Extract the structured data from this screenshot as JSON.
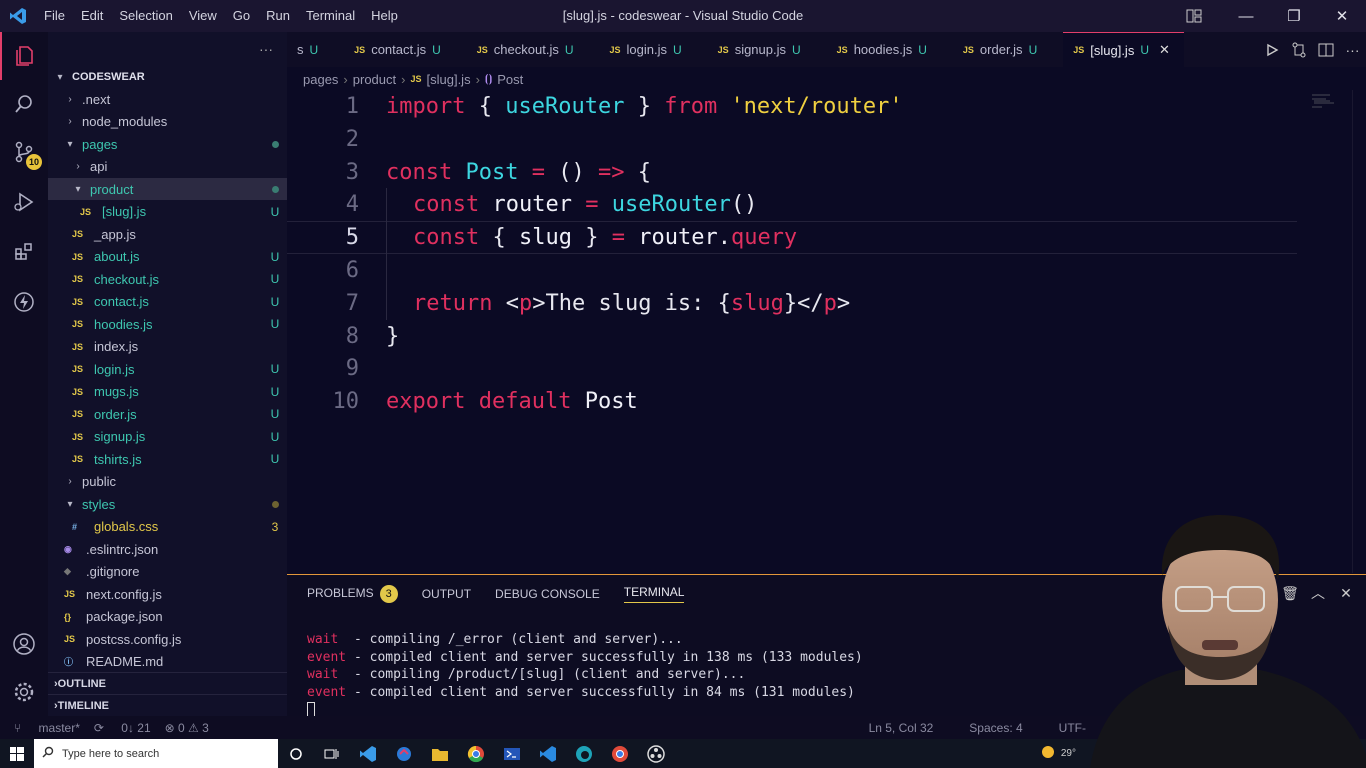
{
  "window": {
    "title": "[slug].js - codeswear - Visual Studio Code",
    "menu": [
      "File",
      "Edit",
      "Selection",
      "View",
      "Go",
      "Run",
      "Terminal",
      "Help"
    ]
  },
  "activity_bar": {
    "source_control_badge": "10"
  },
  "sidebar": {
    "more_label": "···",
    "project": "CODESWEAR",
    "tree": [
      {
        "label": ".next",
        "kind": "folder",
        "depth": 1,
        "open": false,
        "status": ""
      },
      {
        "label": "node_modules",
        "kind": "folder",
        "depth": 1,
        "open": false,
        "status": ""
      },
      {
        "label": "pages",
        "kind": "folder",
        "depth": 1,
        "open": true,
        "status": "dot"
      },
      {
        "label": "api",
        "kind": "folder",
        "depth": 2,
        "open": false,
        "status": ""
      },
      {
        "label": "product",
        "kind": "folder",
        "depth": 2,
        "open": true,
        "status": "dot",
        "selected": true
      },
      {
        "label": "[slug].js",
        "kind": "js",
        "depth": 3,
        "status": "U"
      },
      {
        "label": "_app.js",
        "kind": "js",
        "depth": 2,
        "status": ""
      },
      {
        "label": "about.js",
        "kind": "js",
        "depth": 2,
        "status": "U"
      },
      {
        "label": "checkout.js",
        "kind": "js",
        "depth": 2,
        "status": "U"
      },
      {
        "label": "contact.js",
        "kind": "js",
        "depth": 2,
        "status": "U"
      },
      {
        "label": "hoodies.js",
        "kind": "js",
        "depth": 2,
        "status": "U"
      },
      {
        "label": "index.js",
        "kind": "js",
        "depth": 2,
        "status": ""
      },
      {
        "label": "login.js",
        "kind": "js",
        "depth": 2,
        "status": "U"
      },
      {
        "label": "mugs.js",
        "kind": "js",
        "depth": 2,
        "status": "U"
      },
      {
        "label": "order.js",
        "kind": "js",
        "depth": 2,
        "status": "U"
      },
      {
        "label": "signup.js",
        "kind": "js",
        "depth": 2,
        "status": "U"
      },
      {
        "label": "tshirts.js",
        "kind": "js",
        "depth": 2,
        "status": "U"
      },
      {
        "label": "public",
        "kind": "folder",
        "depth": 1,
        "open": false,
        "status": ""
      },
      {
        "label": "styles",
        "kind": "folder",
        "depth": 1,
        "open": true,
        "status": "ydot"
      },
      {
        "label": "globals.css",
        "kind": "css",
        "depth": 2,
        "status": "3"
      },
      {
        "label": ".eslintrc.json",
        "kind": "eslint",
        "depth": 1,
        "status": ""
      },
      {
        "label": ".gitignore",
        "kind": "git",
        "depth": 1,
        "status": ""
      },
      {
        "label": "next.config.js",
        "kind": "js",
        "depth": 1,
        "status": ""
      },
      {
        "label": "package.json",
        "kind": "json",
        "depth": 1,
        "status": ""
      },
      {
        "label": "postcss.config.js",
        "kind": "js",
        "depth": 1,
        "status": ""
      },
      {
        "label": "README.md",
        "kind": "md",
        "depth": 1,
        "status": ""
      }
    ],
    "outline": "OUTLINE",
    "timeline": "TIMELINE"
  },
  "tabs": [
    {
      "label": "s",
      "u": "U",
      "partial": true
    },
    {
      "label": "contact.js",
      "u": "U"
    },
    {
      "label": "checkout.js",
      "u": "U"
    },
    {
      "label": "login.js",
      "u": "U"
    },
    {
      "label": "signup.js",
      "u": "U"
    },
    {
      "label": "hoodies.js",
      "u": "U"
    },
    {
      "label": "order.js",
      "u": "U"
    },
    {
      "label": "[slug].js",
      "u": "U",
      "active": true
    }
  ],
  "breadcrumb": {
    "parts": [
      "pages",
      "product",
      "[slug].js",
      "Post"
    ]
  },
  "editor": {
    "current_line": 5,
    "lines": [
      {
        "n": "1",
        "indent": 0,
        "tokens": [
          [
            "k",
            "import"
          ],
          [
            "p",
            " { "
          ],
          [
            "f",
            "useRouter"
          ],
          [
            "p",
            " } "
          ],
          [
            "k",
            "from"
          ],
          [
            "p",
            " "
          ],
          [
            "s",
            "'next/router'"
          ]
        ]
      },
      {
        "n": "2",
        "indent": 0,
        "tokens": []
      },
      {
        "n": "3",
        "indent": 0,
        "tokens": [
          [
            "k",
            "const"
          ],
          [
            "p",
            " "
          ],
          [
            "f",
            "Post"
          ],
          [
            "p",
            " "
          ],
          [
            "k",
            "="
          ],
          [
            "p",
            " () "
          ],
          [
            "k",
            "=>"
          ],
          [
            "p",
            " {"
          ]
        ]
      },
      {
        "n": "4",
        "indent": 1,
        "tokens": [
          [
            "k",
            "const"
          ],
          [
            "p",
            " "
          ],
          [
            "v",
            "router"
          ],
          [
            "p",
            " "
          ],
          [
            "k",
            "="
          ],
          [
            "p",
            " "
          ],
          [
            "f",
            "useRouter"
          ],
          [
            "p",
            "()"
          ]
        ]
      },
      {
        "n": "5",
        "indent": 1,
        "tokens": [
          [
            "k",
            "const"
          ],
          [
            "p",
            " { "
          ],
          [
            "v",
            "slug"
          ],
          [
            "p",
            " } "
          ],
          [
            "k",
            "="
          ],
          [
            "p",
            " "
          ],
          [
            "v",
            "router"
          ],
          [
            "p",
            "."
          ],
          [
            "pr",
            "query"
          ]
        ]
      },
      {
        "n": "6",
        "indent": 1,
        "tokens": []
      },
      {
        "n": "7",
        "indent": 1,
        "tokens": [
          [
            "k",
            "return"
          ],
          [
            "p",
            " <"
          ],
          [
            "t",
            "p"
          ],
          [
            "p",
            ">The slug is: {"
          ],
          [
            "pr",
            "slug"
          ],
          [
            "p",
            "}</"
          ],
          [
            "t",
            "p"
          ],
          [
            "p",
            ">"
          ]
        ]
      },
      {
        "n": "8",
        "indent": 0,
        "tokens": [
          [
            "p",
            "}"
          ]
        ]
      },
      {
        "n": "9",
        "indent": 0,
        "tokens": []
      },
      {
        "n": "10",
        "indent": 0,
        "tokens": [
          [
            "k",
            "export"
          ],
          [
            "p",
            " "
          ],
          [
            "k",
            "default"
          ],
          [
            "p",
            " "
          ],
          [
            "v",
            "Post"
          ]
        ]
      }
    ]
  },
  "panel": {
    "tabs": [
      "PROBLEMS",
      "OUTPUT",
      "DEBUG CONSOLE",
      "TERMINAL"
    ],
    "problems_count": "3",
    "active": "TERMINAL",
    "terminal": [
      {
        "tag": "wait",
        "text": "  - compiling /_error (client and server)..."
      },
      {
        "tag": "event",
        "text": " - compiled client and server successfully in 138 ms (133 modules)"
      },
      {
        "tag": "wait",
        "text": "  - compiling /product/[slug] (client and server)..."
      },
      {
        "tag": "event",
        "text": " - compiled client and server successfully in 84 ms (131 modules)"
      }
    ]
  },
  "status": {
    "branch": "master*",
    "sync": "0↓ 21",
    "problems": "⊗ 0 ⚠ 3",
    "position": "Ln 5, Col 32",
    "spaces": "Spaces: 4",
    "encoding": "UTF-"
  },
  "taskbar": {
    "search_placeholder": "Type here to search",
    "weather": "29°"
  },
  "colors": {
    "keyword": "#e0305f",
    "function": "#3dd6e0",
    "string": "#f0d040",
    "untracked": "#3ec7b0",
    "accent": "#e23e6a"
  }
}
